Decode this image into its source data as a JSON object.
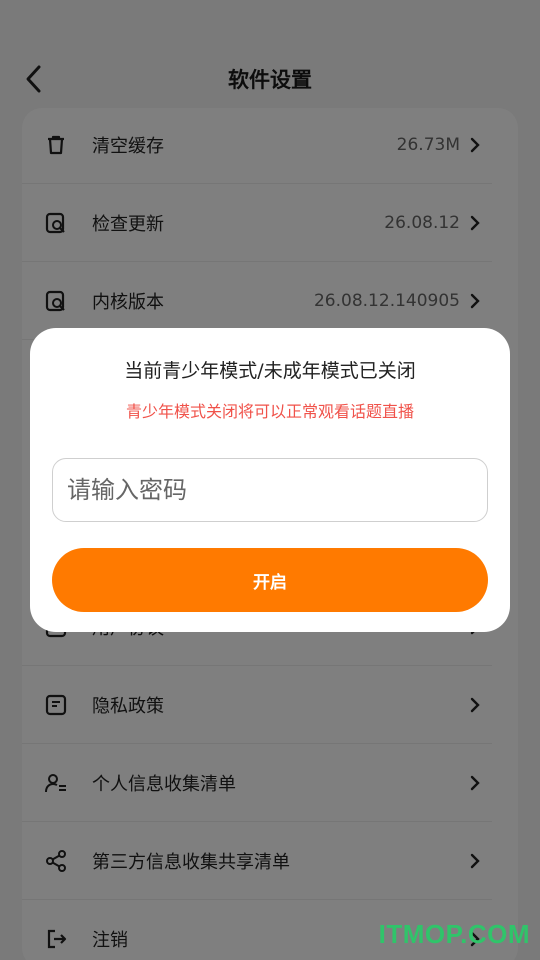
{
  "header": {
    "title": "软件设置"
  },
  "settings": {
    "rows": [
      {
        "label": "清空缓存",
        "value": "26.73M",
        "icon": "trash-icon"
      },
      {
        "label": "检查更新",
        "value": "26.08.12",
        "icon": "search-doc-icon"
      },
      {
        "label": "内核版本",
        "value": "26.08.12.140905",
        "icon": "search-doc-icon"
      },
      {
        "label": "用户协议",
        "value": "",
        "icon": "document-icon"
      },
      {
        "label": "隐私政策",
        "value": "",
        "icon": "document-icon"
      },
      {
        "label": "个人信息收集清单",
        "value": "",
        "icon": "user-list-icon"
      },
      {
        "label": "第三方信息收集共享清单",
        "value": "",
        "icon": "share-icon"
      },
      {
        "label": "注销",
        "value": "",
        "icon": "logout-icon"
      }
    ]
  },
  "dialog": {
    "title": "当前青少年模式/未成年模式已关闭",
    "subtitle": "青少年模式关闭将可以正常观看话题直播",
    "password_placeholder": "请输入密码",
    "open_label": "开启"
  },
  "watermark": "ITMOP.COM",
  "colors": {
    "accent": "#ff7a00",
    "warning_text": "#f0524a",
    "watermark": "#30c46a"
  }
}
